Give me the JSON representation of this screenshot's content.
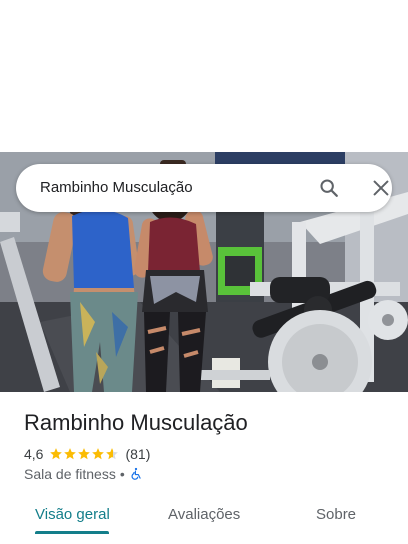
{
  "search": {
    "query": "Rambinho Musculação"
  },
  "place": {
    "name": "Rambinho Musculação",
    "rating": "4,6",
    "stars": 4.6,
    "review_count": "(81)",
    "category": "Sala de fitness",
    "separator": "•"
  },
  "tabs": [
    {
      "label": "Visão geral",
      "selected": true
    },
    {
      "label": "Avaliações",
      "selected": false
    },
    {
      "label": "Sobre",
      "selected": false
    }
  ],
  "colors": {
    "accent": "#137e8a",
    "star": "#fbbc04",
    "accessible": "#1a73e8"
  },
  "icons": [
    "search-icon",
    "close-icon",
    "star-icon",
    "wheelchair-accessible-icon"
  ]
}
